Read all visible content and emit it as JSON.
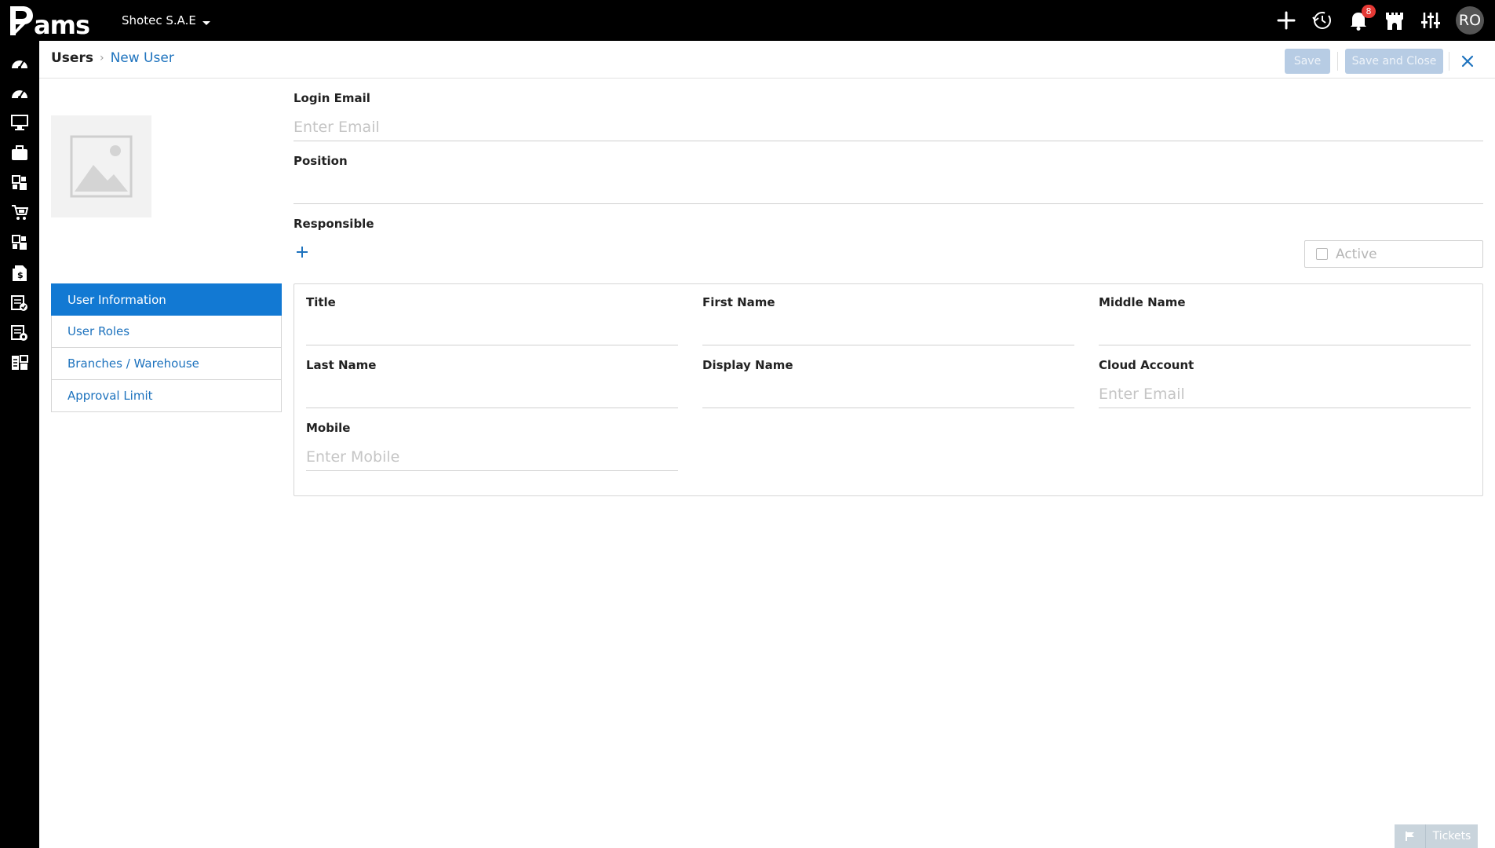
{
  "app": {
    "logo_text": "Rams",
    "company": "Shotec S.A.E",
    "notifications_count": "8",
    "user_initials": "RO"
  },
  "top_icons": [
    "add-icon",
    "history-icon",
    "bell-icon",
    "castle-icon",
    "sliders-icon"
  ],
  "sidebar_icons": [
    "dashboard-icon",
    "dashboard-icon",
    "monitor-icon",
    "briefcase-icon",
    "modules-icon",
    "cart-icon",
    "modules-icon",
    "invoice-dollar-icon",
    "document-check-icon",
    "document-settings-icon",
    "layout-icon"
  ],
  "breadcrumb": {
    "root": "Users",
    "current": "New User"
  },
  "toolbar": {
    "save_label": "Save",
    "save_close_label": "Save and Close"
  },
  "nav": {
    "items": [
      {
        "label": "User Information"
      },
      {
        "label": "User Roles"
      },
      {
        "label": "Branches / Warehouse"
      },
      {
        "label": "Approval Limit"
      }
    ]
  },
  "form": {
    "login_email": {
      "label": "Login Email",
      "value": "",
      "placeholder": "Enter Email"
    },
    "position": {
      "label": "Position",
      "value": "",
      "placeholder": ""
    },
    "responsible": {
      "label": "Responsible"
    },
    "active": {
      "label": "Active",
      "checked": false
    },
    "title": {
      "label": "Title",
      "value": "",
      "placeholder": ""
    },
    "first_name": {
      "label": "First Name",
      "value": "",
      "placeholder": ""
    },
    "middle_name": {
      "label": "Middle Name",
      "value": "",
      "placeholder": ""
    },
    "last_name": {
      "label": "Last Name",
      "value": "",
      "placeholder": ""
    },
    "display_name": {
      "label": "Display Name",
      "value": "",
      "placeholder": ""
    },
    "cloud_account": {
      "label": "Cloud Account",
      "value": "",
      "placeholder": "Enter Email"
    },
    "mobile": {
      "label": "Mobile",
      "value": "",
      "placeholder": "Enter Mobile"
    }
  },
  "footer": {
    "tickets_label": "Tickets"
  },
  "colors": {
    "accent": "#1279d3",
    "link": "#1e73be",
    "topbar": "#000000",
    "disabled_button": "#b7cce4",
    "badge": "#e53935"
  }
}
